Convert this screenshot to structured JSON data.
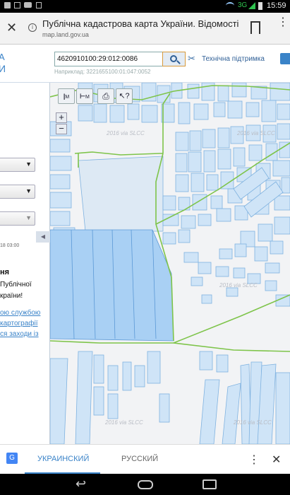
{
  "status": {
    "network": "3G",
    "time": "15:59"
  },
  "browser": {
    "title": "Публічна кадастрова карта України. Відомості та...",
    "url": "map.land.gov.ua"
  },
  "site": {
    "logo_line1": "А",
    "logo_line2": "И",
    "search_value": "4620910100:29:012:0086",
    "example_text": "Наприклад: 3221655100:01:047:0052",
    "support_label": "Технічна підтримка"
  },
  "panel": {
    "date_text": "18 03:00",
    "heading": "ня",
    "text_line1": "Публічної",
    "text_line2": "країни!",
    "link1": "ою службою",
    "link2": "картографії",
    "link3": "ся заходи із"
  },
  "map": {
    "watermark": "2016 via SLCC",
    "tools": {
      "measure_line": "M",
      "measure_area": "M"
    }
  },
  "translate": {
    "lang1": "УКРАИНСКИЙ",
    "lang2": "РУССКИЙ"
  },
  "colors": {
    "accent": "#3a83c8",
    "parcel_fill": "#cfe4f7",
    "parcel_stroke": "#7fb2e0",
    "boundary": "#7ec44a",
    "selected": "#a9d0f4"
  }
}
